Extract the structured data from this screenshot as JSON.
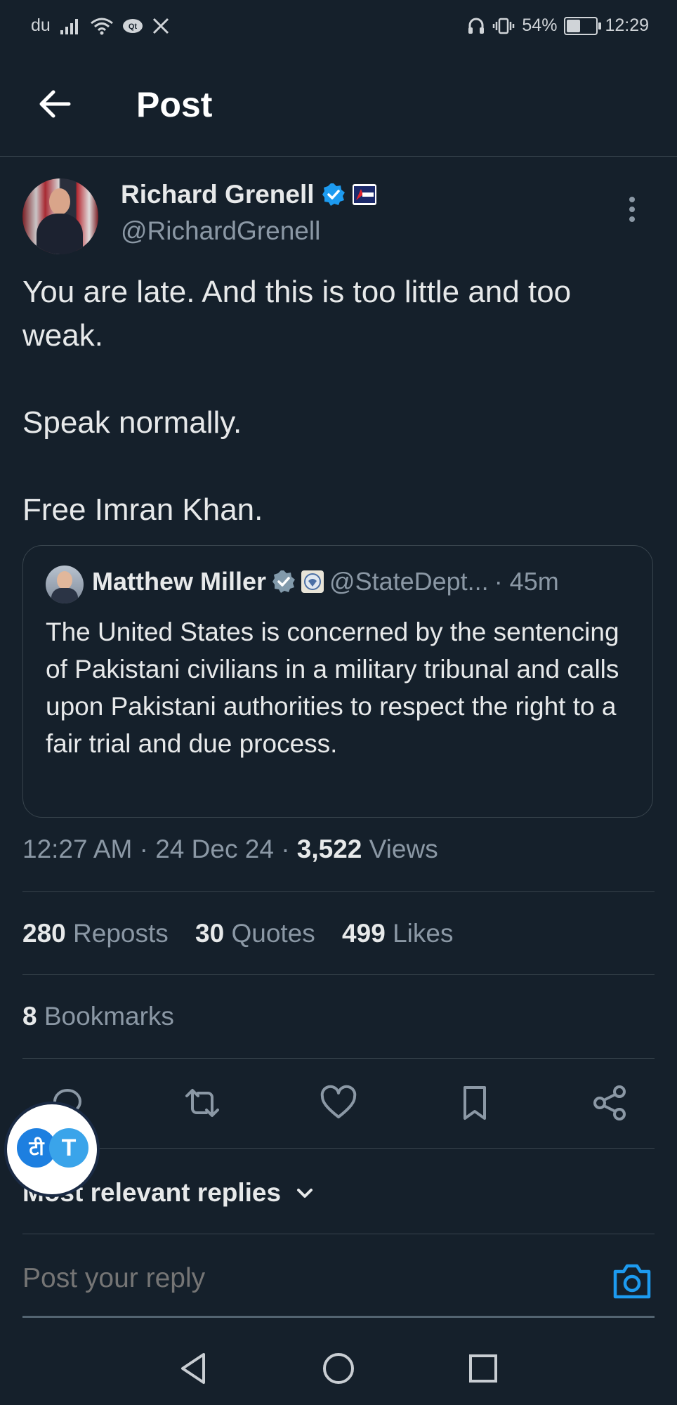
{
  "status_bar": {
    "carrier": "du",
    "battery": "54%",
    "battery_level": 0.54,
    "time": "12:29"
  },
  "header": {
    "title": "Post"
  },
  "post": {
    "author_name": "Richard Grenell",
    "author_handle": "@RichardGrenell",
    "text": "You are late. And this is too little and too weak.\n\nSpeak normally.\n\nFree Imran Khan.",
    "quote": {
      "author_name": "Matthew Miller",
      "author_handle": "@StateDept...",
      "age": "· 45m",
      "text": "The United States is concerned by the sentencing of Pakistani civilians in a military tribunal and calls upon Pakistani authorities to respect the right to a fair trial and due process."
    },
    "time": "12:27 AM",
    "date": "24 Dec 24",
    "views_count": "3,522",
    "views_label": "Views",
    "reposts_count": "280",
    "reposts_label": "Reposts",
    "quotes_count": "30",
    "quotes_label": "Quotes",
    "likes_count": "499",
    "likes_label": "Likes",
    "bookmarks_count": "8",
    "bookmarks_label": "Bookmarks"
  },
  "replies": {
    "sort_label": "Most relevant replies",
    "composer_placeholder": "Post your reply"
  },
  "translate_widget": {
    "source_glyph": "टी",
    "target_glyph": "T"
  },
  "colors": {
    "background": "#15202b",
    "accent": "#1d9bf0",
    "muted": "#8b98a5",
    "divider": "#38444d"
  }
}
